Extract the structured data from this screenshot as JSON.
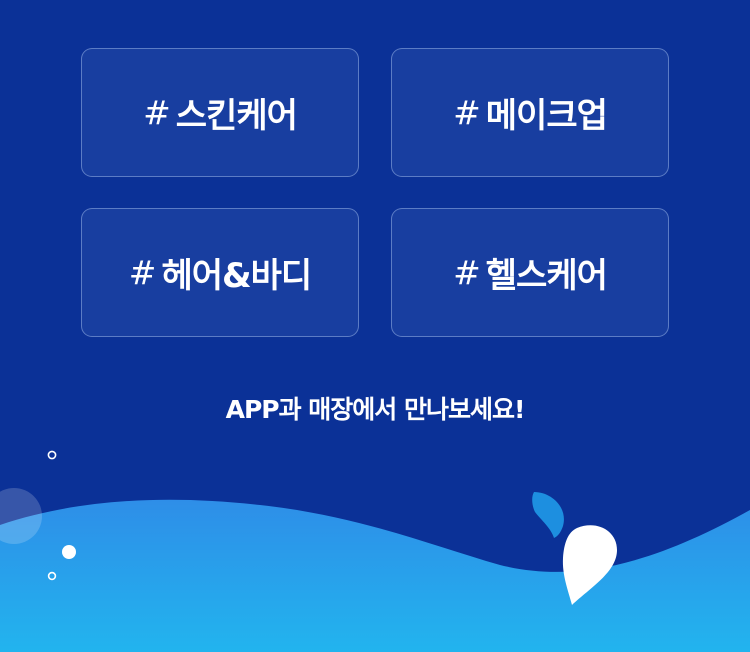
{
  "categories": [
    {
      "hash": "#",
      "label": "스킨케어"
    },
    {
      "hash": "#",
      "label": "메이크업"
    },
    {
      "hash": "#",
      "label": "헤어&바디"
    },
    {
      "hash": "#",
      "label": "헬스케어"
    }
  ],
  "cta": {
    "text": "APP과 매장에서 만나보세요!"
  },
  "colors": {
    "background": "#0b3197",
    "wave_top": "#2e8ee8",
    "wave_bottom": "#22b4ee",
    "drop_blue": "#1d8fe0",
    "drop_white": "#ffffff"
  }
}
